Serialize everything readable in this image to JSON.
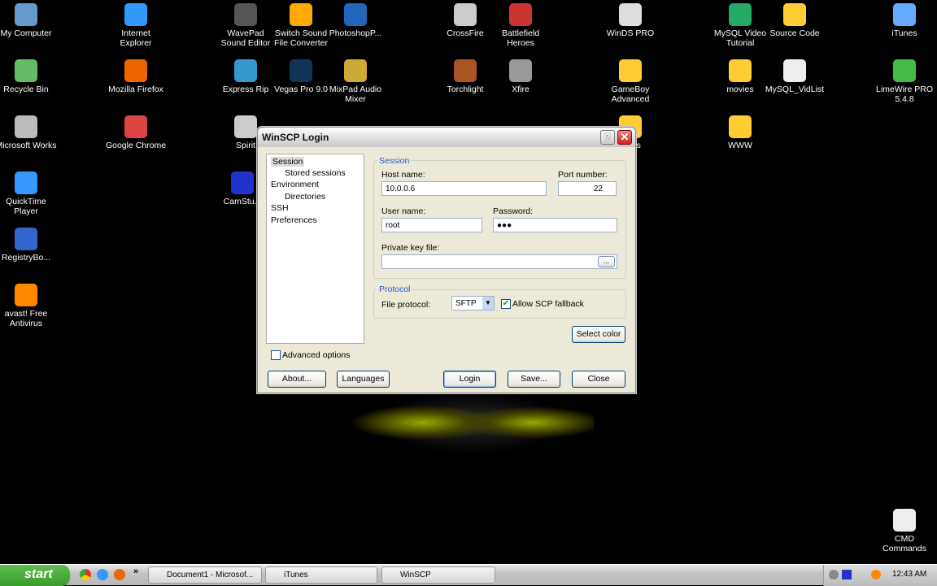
{
  "desktop": {
    "icons": [
      "My Computer",
      "Internet Explorer",
      "WavePad Sound Editor",
      "Switch Sound File Converter",
      "PhotoshopP...",
      "CrossFire",
      "Battlefield Heroes",
      "WinDS PRO",
      "MySQL Video Tutorial",
      "Source Code",
      "iTunes",
      "Recycle Bin",
      "Mozilla Firefox",
      "Express Rip",
      "Vegas Pro 9.0",
      "MixPad Audio Mixer",
      "Torchlight",
      "Xfire",
      "GameBoy Advanced",
      "movies",
      "MySQL_VidList",
      "LimeWire PRO 5.4.8",
      "Microsoft Works",
      "Google Chrome",
      "Spirit",
      "...nes",
      "WWW",
      "QuickTime Player",
      "CamStu...",
      "RegistryBo...",
      "avast! Free Antivirus",
      "CMD Commands"
    ]
  },
  "dialog": {
    "title": "WinSCP Login",
    "help": "?",
    "close": "✕",
    "tree": [
      "Session",
      "Stored sessions",
      "Environment",
      "Directories",
      "SSH",
      "Preferences"
    ],
    "session_group": "Session",
    "host_label": "Host name:",
    "host": "10.0.0.6",
    "port_label": "Port number:",
    "port": "22",
    "user_label": "User name:",
    "user": "root",
    "password_label": "Password:",
    "password": "●●●",
    "key_label": "Private key file:",
    "key": "",
    "browse": "...",
    "protocol_group": "Protocol",
    "protocol_label": "File protocol:",
    "protocol": "SFTP",
    "scp_fallback": "Allow SCP fallback",
    "scp_checked": true,
    "select_color": "Select color",
    "advanced": "Advanced options",
    "advanced_checked": false,
    "buttons": {
      "about": "About...",
      "languages": "Languages",
      "login": "Login",
      "save": "Save...",
      "close": "Close"
    }
  },
  "taskbar": {
    "start": "start",
    "tasks": [
      "Document1 - Microsof...",
      "iTunes",
      "WinSCP"
    ],
    "more": "»",
    "clock": "12:43 AM"
  }
}
